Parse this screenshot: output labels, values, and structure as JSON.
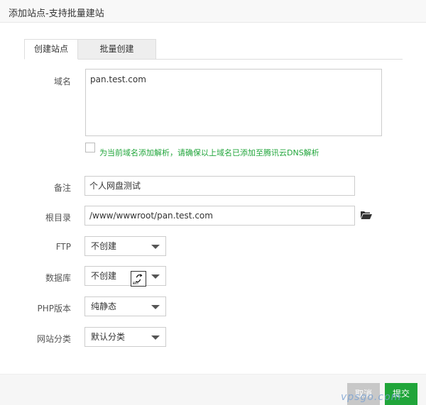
{
  "dialog": {
    "title": "添加站点-支持批量建站"
  },
  "tabs": [
    {
      "label": "创建站点",
      "active": true
    },
    {
      "label": "批量创建",
      "active": false
    }
  ],
  "form": {
    "domain": {
      "label": "域名",
      "value": "pan.test.com"
    },
    "dns_hint": {
      "checked": false,
      "text": "为当前域名添加解析，请确保以上域名已添加至腾讯云DNS解析"
    },
    "remark": {
      "label": "备注",
      "value": "个人网盘测试"
    },
    "root": {
      "label": "根目录",
      "value": "/www/wwwroot/pan.test.com"
    },
    "ftp": {
      "label": "FTP",
      "value": "不创建"
    },
    "database": {
      "label": "数据库",
      "value": "不创建"
    },
    "php": {
      "label": "PHP版本",
      "value": "纯静态"
    },
    "category": {
      "label": "网站分类",
      "value": "默认分类"
    }
  },
  "buttons": {
    "cancel": "取消",
    "submit": "提交"
  },
  "watermark": "vpsgo.com",
  "colors": {
    "accent": "#20a53a",
    "cancel": "#c8c8c8"
  }
}
